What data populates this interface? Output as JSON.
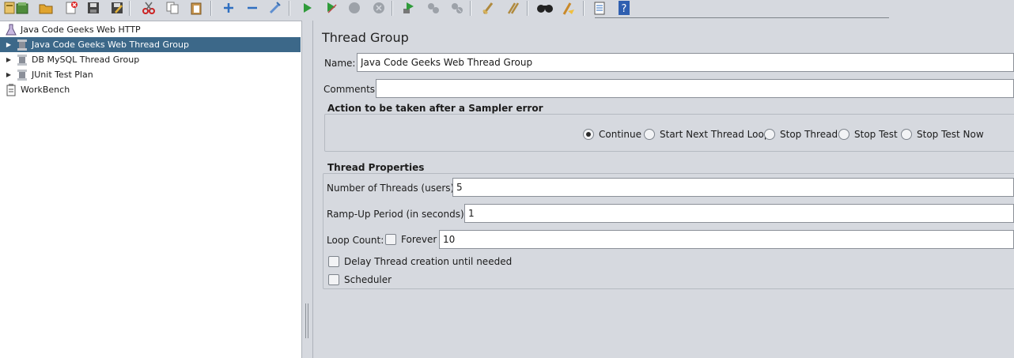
{
  "toolbar": {
    "icons": [
      "new-test-plan-icon",
      "templates-icon",
      "open-icon",
      "close-icon",
      "save-icon",
      "save-as-icon",
      "cut-icon",
      "copy-icon",
      "paste-icon",
      "expand-all-icon",
      "collapse-all-icon",
      "toggle-icon",
      "start-icon",
      "start-no-pauses-icon",
      "stop-icon",
      "shutdown-icon",
      "remote-start-icon",
      "remote-stop-icon",
      "remote-shutdown-icon",
      "clear-icon",
      "clear-all-icon",
      "search-icon",
      "reset-search-icon",
      "function-helper-icon",
      "help-icon"
    ]
  },
  "tree": {
    "root": "Java Code Geeks Web HTTP",
    "items": [
      {
        "label": "Java Code Geeks Web Thread Group",
        "selected": true
      },
      {
        "label": "DB MySQL Thread Group",
        "selected": false
      },
      {
        "label": "JUnit Test Plan",
        "selected": false
      }
    ],
    "workbench": "WorkBench"
  },
  "main": {
    "title": "Thread Group",
    "name_label": "Name:",
    "name_value": "Java Code Geeks Web Thread Group",
    "comments_label": "Comments:",
    "comments_value": "",
    "sampler_error": {
      "title": "Action to be taken after a Sampler error",
      "options": [
        {
          "label": "Continue",
          "checked": true
        },
        {
          "label": "Start Next Thread Loop",
          "checked": false
        },
        {
          "label": "Stop Thread",
          "checked": false
        },
        {
          "label": "Stop Test",
          "checked": false
        },
        {
          "label": "Stop Test Now",
          "checked": false
        }
      ]
    },
    "thread_properties": {
      "title": "Thread Properties",
      "threads_label": "Number of Threads (users):",
      "threads_value": "5",
      "rampup_label": "Ramp-Up Period (in seconds):",
      "rampup_value": "1",
      "loop_label": "Loop Count:",
      "forever_label": "Forever",
      "forever_checked": false,
      "loop_value": "10",
      "delay_label": "Delay Thread creation until needed",
      "delay_checked": false,
      "scheduler_label": "Scheduler",
      "scheduler_checked": false
    }
  },
  "colors": {
    "selection": "#3c6889",
    "panel_bg": "#d6d9df",
    "tree_bg": "#ffffff"
  }
}
